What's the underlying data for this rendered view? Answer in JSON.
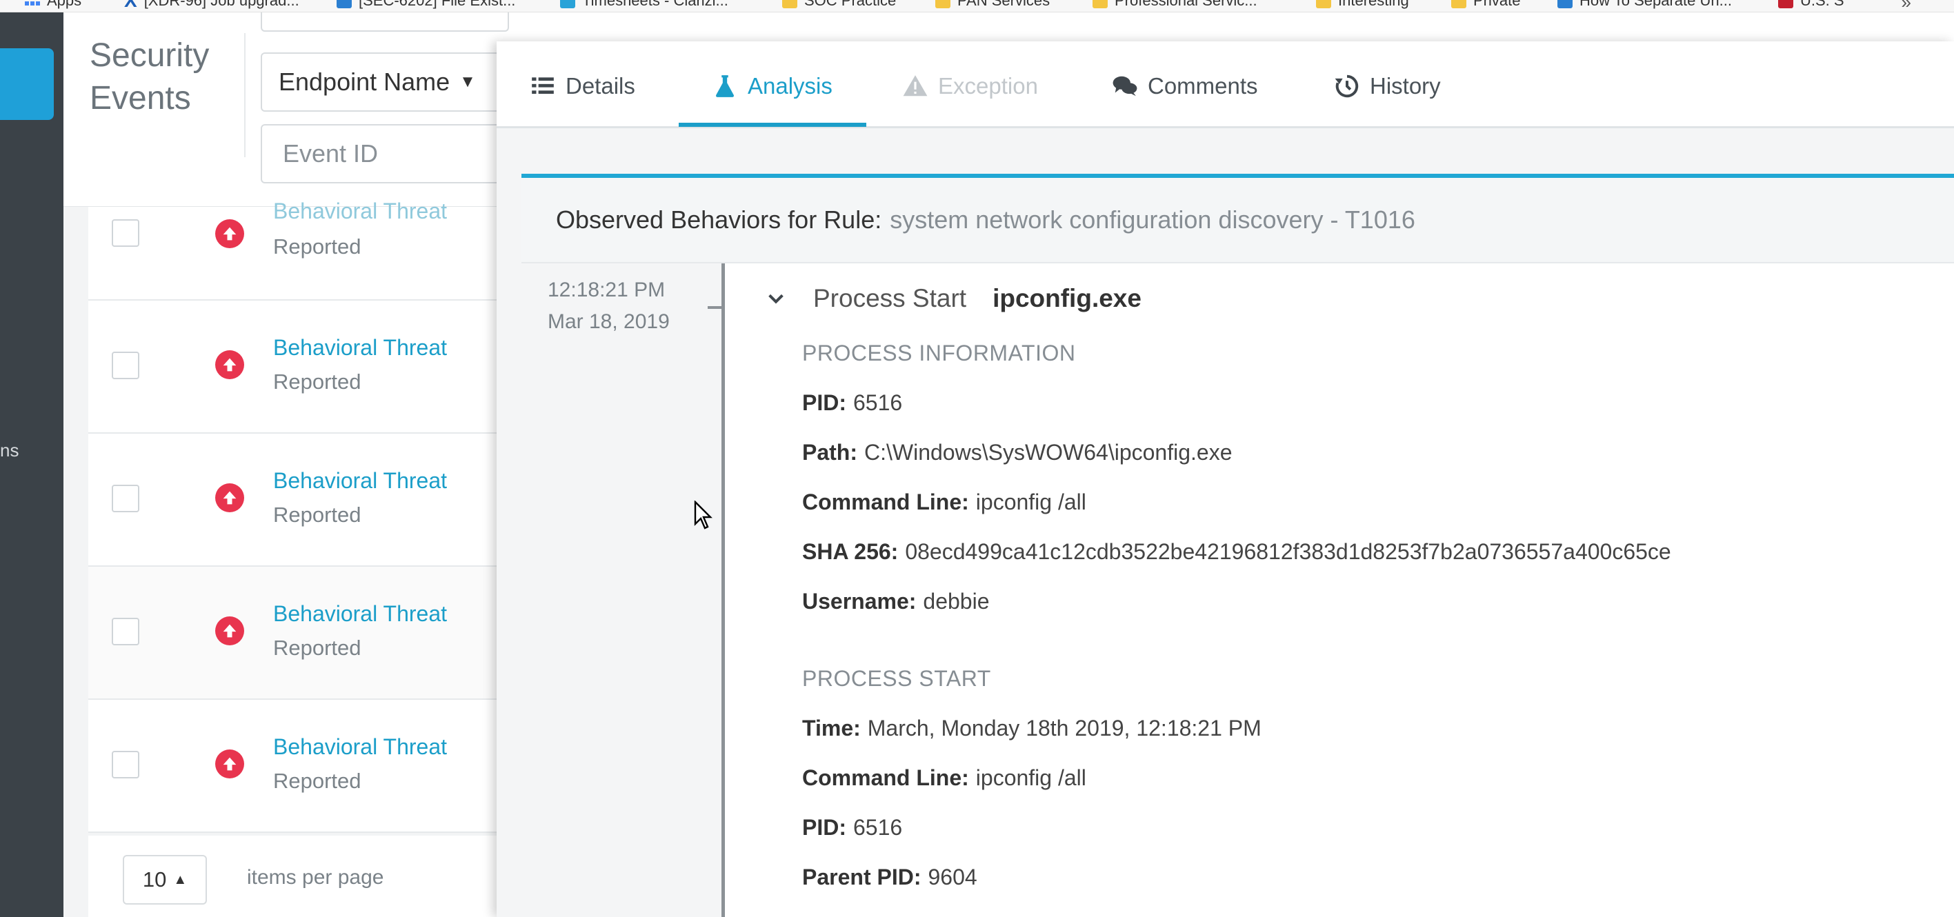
{
  "bookmarks": [
    {
      "label": "Apps",
      "icon": "apps-grid-icon"
    },
    {
      "label": "[XDR-96] Job upgrad...",
      "icon": "x-logo-icon"
    },
    {
      "label": "[SEC-6202] File Exist...",
      "icon": "jira-icon"
    },
    {
      "label": "Timesheets - Clarizi...",
      "icon": "clarizen-icon"
    },
    {
      "label": "SOC Practice",
      "icon": "folder-icon"
    },
    {
      "label": "PAN Services",
      "icon": "folder-icon"
    },
    {
      "label": "Professional Servic...",
      "icon": "folder-icon"
    },
    {
      "label": "Interesting",
      "icon": "folder-icon"
    },
    {
      "label": "Private",
      "icon": "folder-icon"
    },
    {
      "label": "How To Separate Un...",
      "icon": "bookmark-icon"
    },
    {
      "label": "U.S. S",
      "icon": "flag-icon"
    }
  ],
  "leftnav": {
    "partial_label": "ns"
  },
  "list": {
    "title": "Security Events",
    "filter_select": "Endpoint Name",
    "filter_input_placeholder": "Event ID",
    "rows": [
      {
        "name": "Behavioral Threat",
        "status": "Reported",
        "severity_icon": "high-severity-arrow-icon"
      },
      {
        "name": "Behavioral Threat",
        "status": "Reported",
        "severity_icon": "high-severity-arrow-icon"
      },
      {
        "name": "Behavioral Threat",
        "status": "Reported",
        "severity_icon": "high-severity-arrow-icon"
      },
      {
        "name": "Behavioral Threat",
        "status": "Reported",
        "severity_icon": "high-severity-arrow-icon"
      },
      {
        "name": "Behavioral Threat",
        "status": "Reported",
        "severity_icon": "high-severity-arrow-icon"
      }
    ],
    "pager": {
      "page_size": "10",
      "label": "items per page"
    }
  },
  "tabs": [
    {
      "label": "Details",
      "icon": "list-icon",
      "state": "normal"
    },
    {
      "label": "Analysis",
      "icon": "flask-icon",
      "state": "active"
    },
    {
      "label": "Exception",
      "icon": "warning-icon",
      "state": "disabled"
    },
    {
      "label": "Comments",
      "icon": "comments-icon",
      "state": "normal"
    },
    {
      "label": "History",
      "icon": "history-icon",
      "state": "normal"
    }
  ],
  "behaviors": {
    "header_label": "Observed Behaviors for Rule:",
    "rule": "system network configuration discovery - T1016",
    "time": "12:18:21 PM",
    "date": "Mar 18, 2019",
    "event_type": "Process Start",
    "process_name": "ipconfig.exe",
    "sections": [
      {
        "title": "PROCESS INFORMATION",
        "fields": [
          {
            "key": "PID:",
            "value": "6516"
          },
          {
            "key": "Path:",
            "value": "C:\\Windows\\SysWOW64\\ipconfig.exe"
          },
          {
            "key": "Command Line:",
            "value": "ipconfig /all"
          },
          {
            "key": "SHA 256:",
            "value": "08ecd499ca41c12cdb3522be42196812f383d1d8253f7b2a0736557a400c65ce"
          },
          {
            "key": "Username:",
            "value": "debbie"
          }
        ]
      },
      {
        "title": "PROCESS START",
        "fields": [
          {
            "key": "Time:",
            "value": "March, Monday 18th 2019, 12:18:21 PM"
          },
          {
            "key": "Command Line:",
            "value": "ipconfig /all"
          },
          {
            "key": "PID:",
            "value": "6516"
          },
          {
            "key": "Parent PID:",
            "value": "9604"
          }
        ]
      }
    ]
  },
  "colors": {
    "accent": "#1b9ec9",
    "timeline_top": "#20a7d4",
    "severity_high": "#e8344e",
    "nav_dark": "#3b4248"
  }
}
